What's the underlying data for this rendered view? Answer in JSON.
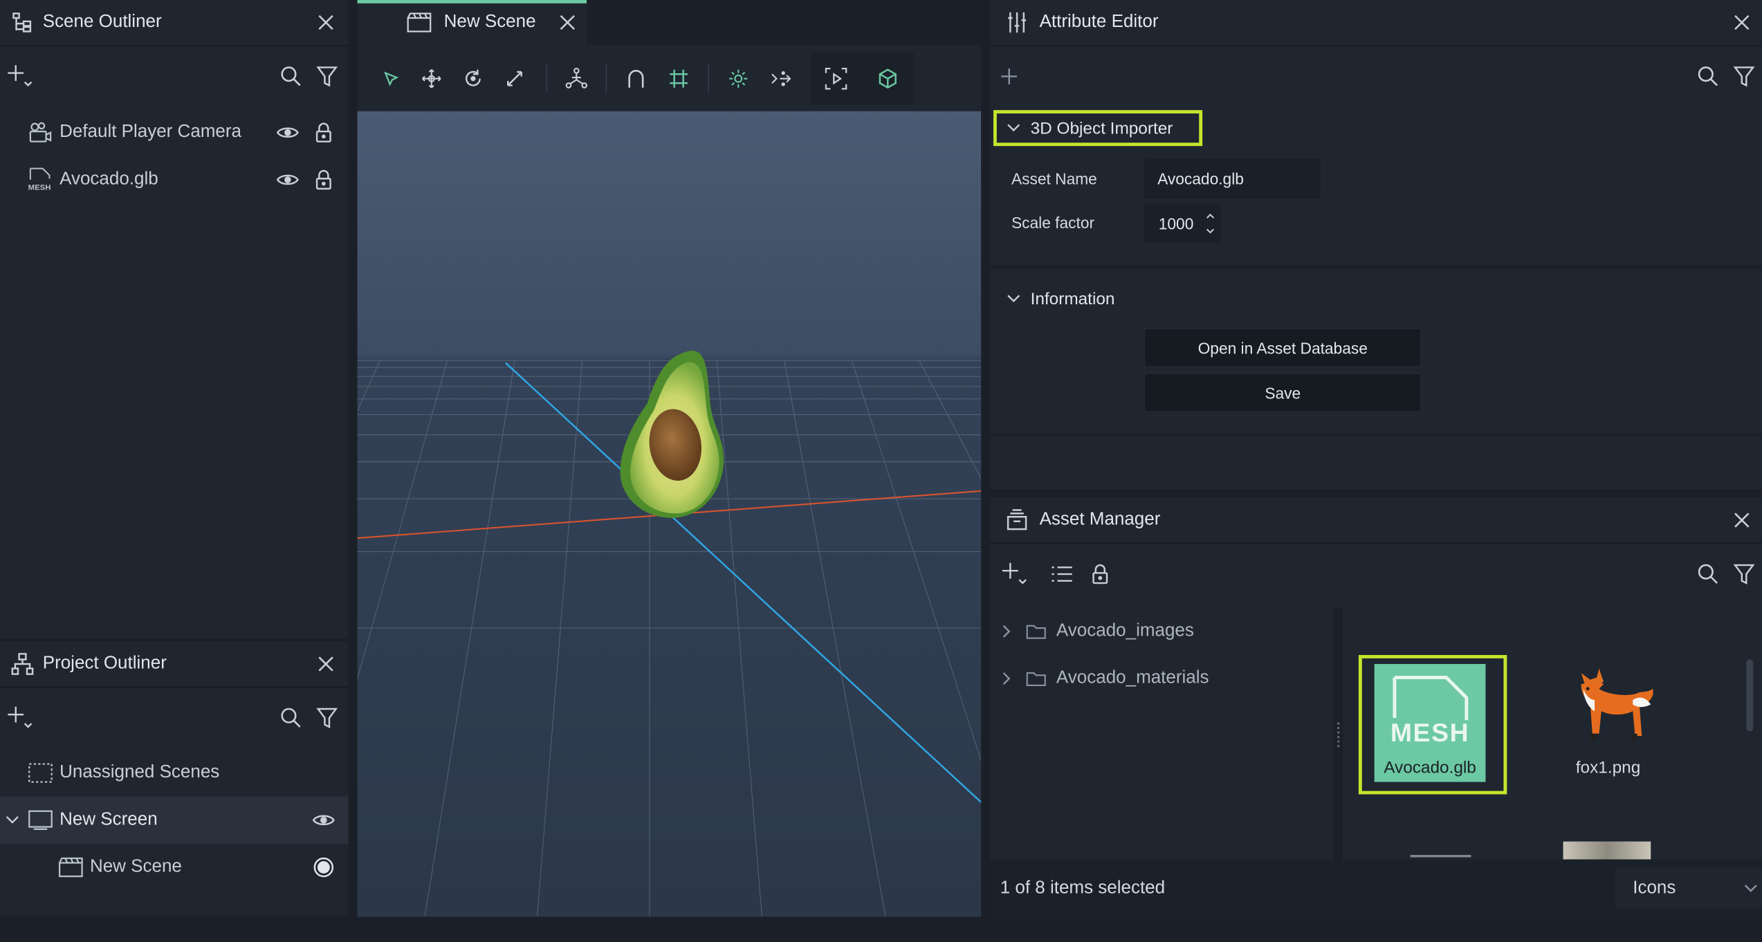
{
  "scene_outliner": {
    "title": "Scene Outliner",
    "items": [
      {
        "label": "Default Player Camera"
      },
      {
        "label": "Avocado.glb"
      }
    ]
  },
  "project_outliner": {
    "title": "Project Outliner",
    "items": [
      {
        "label": "Unassigned Scenes"
      },
      {
        "label": "New Screen"
      },
      {
        "label": "New Scene"
      }
    ]
  },
  "viewport": {
    "tab_label": "New Scene",
    "accent": "#6cc9a3"
  },
  "attribute_editor": {
    "title": "Attribute Editor",
    "section_importer": "3D Object Importer",
    "asset_name_label": "Asset Name",
    "asset_name_value": "Avocado.glb",
    "scale_label": "Scale factor",
    "scale_value": "1000",
    "section_info": "Information",
    "open_db_label": "Open in Asset Database",
    "save_label": "Save",
    "highlight": "#c5e52c"
  },
  "asset_manager": {
    "title": "Asset Manager",
    "folders": [
      {
        "label": "Avocado_images"
      },
      {
        "label": "Avocado_materials"
      }
    ],
    "assets": [
      {
        "label": "Avocado.glb",
        "thumb_text": "MESH",
        "selected": true
      },
      {
        "label": "fox1.png",
        "selected": false
      }
    ],
    "status": "1 of 8 items selected",
    "view_mode": "Icons"
  }
}
